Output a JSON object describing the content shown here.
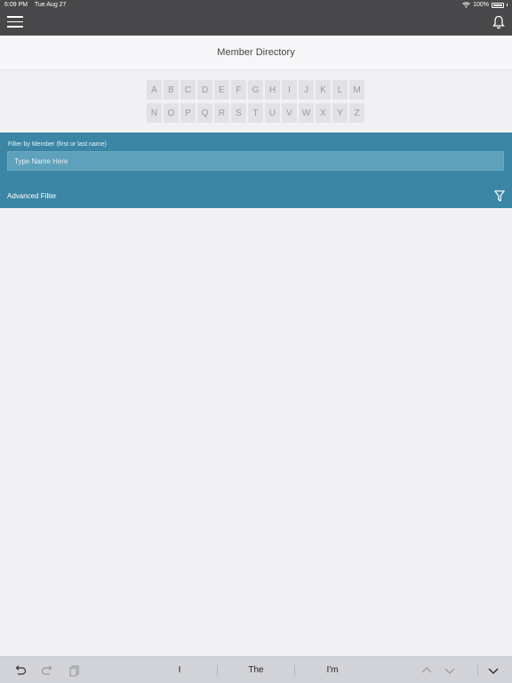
{
  "status": {
    "time": "6:09 PM",
    "date": "Tue Aug 27",
    "battery": "100%"
  },
  "page": {
    "title": "Member Directory"
  },
  "alphabet": {
    "row1": [
      "A",
      "B",
      "C",
      "D",
      "E",
      "F",
      "G",
      "H",
      "I",
      "J",
      "K",
      "L",
      "M"
    ],
    "row2": [
      "N",
      "O",
      "P",
      "Q",
      "R",
      "S",
      "T",
      "U",
      "V",
      "W",
      "X",
      "Y",
      "Z"
    ]
  },
  "filter": {
    "label": "Filter by Member (first or last name)",
    "placeholder": "Type Name Here",
    "value": "",
    "advanced_label": "Advanced Filter"
  },
  "keyboard_bar": {
    "suggestions": [
      "I",
      "The",
      "I'm"
    ]
  },
  "colors": {
    "nav": "#48484b",
    "accent": "#3a86a4",
    "field": "#5ea1bb"
  }
}
